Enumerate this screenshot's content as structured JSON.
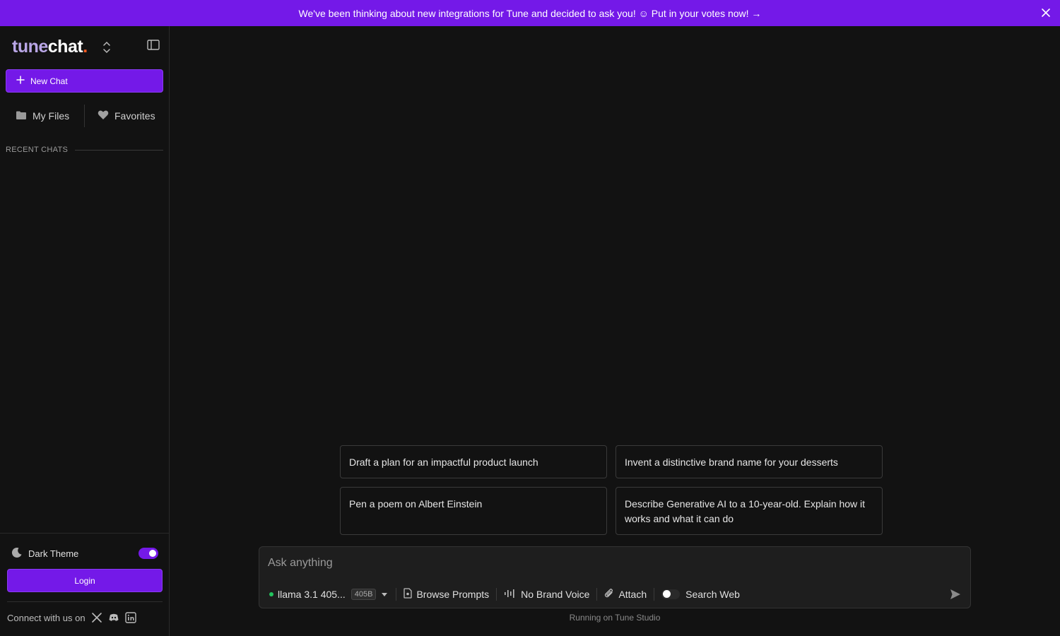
{
  "banner": {
    "text": "We've been thinking about new integrations for Tune and decided to ask you! ☺ Put in your votes now! →"
  },
  "sidebar": {
    "logo": {
      "part1": "tune",
      "part2": "chat",
      "dot": "."
    },
    "new_chat_label": "New Chat",
    "nav": {
      "files_label": "My Files",
      "favorites_label": "Favorites"
    },
    "recent_label": "RECENT CHATS",
    "theme_label": "Dark Theme",
    "login_label": "Login",
    "connect_label": "Connect with us on"
  },
  "suggestions": [
    {
      "text": "Draft a plan for an impactful product launch"
    },
    {
      "text": "Invent a distinctive brand name for your desserts"
    },
    {
      "text": "Pen a poem on Albert Einstein"
    },
    {
      "text": "Describe Generative AI to a 10-year-old. Explain how it works and what it can do"
    }
  ],
  "composer": {
    "placeholder": "Ask anything",
    "model_name": "llama 3.1 405...",
    "model_badge": "405B",
    "browse_label": "Browse Prompts",
    "brand_voice_label": "No Brand Voice",
    "attach_label": "Attach",
    "search_web_label": "Search Web"
  },
  "footer": {
    "text": "Running on Tune Studio"
  },
  "colors": {
    "accent": "#7419e8",
    "background": "#121212",
    "panel": "#1e1e1e",
    "status_green": "#22c55e"
  }
}
